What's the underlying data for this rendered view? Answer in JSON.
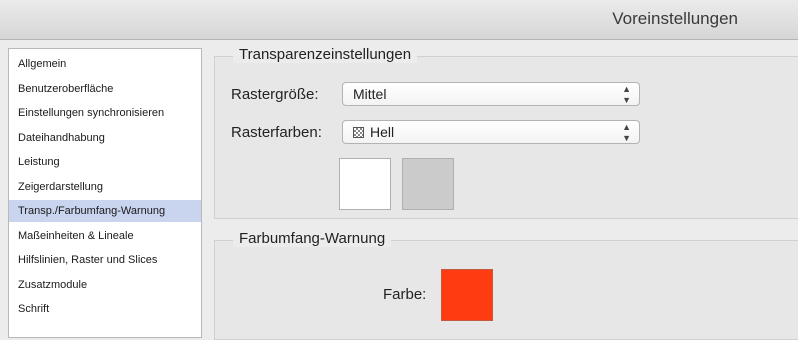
{
  "window": {
    "title": "Voreinstellungen"
  },
  "sidebar": {
    "items": [
      {
        "label": "Allgemein"
      },
      {
        "label": "Benutzeroberfläche"
      },
      {
        "label": "Einstellungen synchronisieren"
      },
      {
        "label": "Dateihandhabung"
      },
      {
        "label": "Leistung"
      },
      {
        "label": "Zeigerdarstellung"
      },
      {
        "label": "Transp./Farbumfang-Warnung"
      },
      {
        "label": "Maßeinheiten & Lineale"
      },
      {
        "label": "Hilfslinien, Raster und Slices"
      },
      {
        "label": "Zusatzmodule"
      },
      {
        "label": "Schrift"
      }
    ],
    "selected_index": 6
  },
  "transparency": {
    "title": "Transparenzeinstellungen",
    "grid_size_label": "Rastergröße:",
    "grid_size_value": "Mittel",
    "grid_colors_label": "Rasterfarben:",
    "grid_colors_value": "Hell",
    "swatch_colors": [
      "#ffffff",
      "#cbcbcb"
    ]
  },
  "gamut_warning": {
    "title": "Farbumfang-Warnung",
    "color_label": "Farbe:",
    "color_value": "#ff3b12"
  },
  "colors": {
    "selection": "#c9d4ee"
  }
}
